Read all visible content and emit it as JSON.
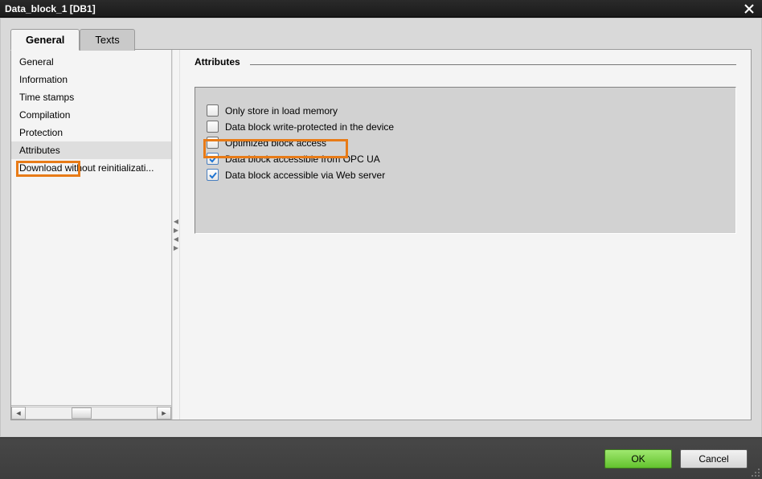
{
  "title": "Data_block_1 [DB1]",
  "tabs": {
    "general": "General",
    "texts": "Texts"
  },
  "nav": {
    "items": [
      "General",
      "Information",
      "Time stamps",
      "Compilation",
      "Protection",
      "Attributes",
      "Download without reinitializati..."
    ]
  },
  "section": {
    "title": "Attributes"
  },
  "attrs": {
    "items": [
      {
        "label": "Only store in load memory",
        "checked": false
      },
      {
        "label": "Data block write-protected in the device",
        "checked": false
      },
      {
        "label": "Optimized block access",
        "checked": false
      },
      {
        "label": "Data block accessible from OPC UA",
        "checked": true
      },
      {
        "label": "Data block accessible via Web server",
        "checked": true
      }
    ]
  },
  "buttons": {
    "ok": "OK",
    "cancel": "Cancel"
  }
}
